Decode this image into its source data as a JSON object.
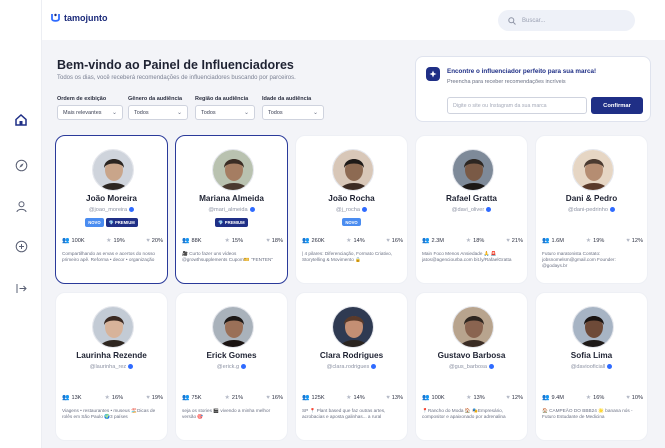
{
  "app": {
    "logo_text": "tamojunto"
  },
  "search": {
    "placeholder": "Buscar..."
  },
  "header": {
    "title": "Bem-vindo ao Painel de Influenciadores",
    "subtitle": "Todos os dias, você receberá recomendações de influenciadores buscando por parceiros."
  },
  "filters": [
    {
      "label": "Ordem de exibição",
      "value": "Mais relevantes"
    },
    {
      "label": "Gênero da audiência",
      "value": "Todos"
    },
    {
      "label": "Região da audiência",
      "value": "Todos"
    },
    {
      "label": "Idade da audiência",
      "value": "Todos"
    }
  ],
  "promo": {
    "title": "Encontre o influenciador perfeito para sua marca!",
    "subtitle": "Preencha para receber recomendações incríveis",
    "input_placeholder": "Digite o site ou Instagram da sua marca",
    "button": "Confirmar"
  },
  "badges": {
    "novo": "NOVO",
    "premium": "💎 PREMIUM"
  },
  "cards": [
    {
      "name": "João Moreira",
      "handle": "@joao_moreira",
      "badges": [
        "novo",
        "premium"
      ],
      "followers": "100K",
      "engagement": "19%",
      "likes": "20%",
      "bio": "Compartilhando as ervas e acertos do nosso primeiro apê. Reforma • decor • organização"
    },
    {
      "name": "Mariana Almeida",
      "handle": "@mari_almeida",
      "badges": [
        "premium"
      ],
      "followers": "88K",
      "engagement": "15%",
      "likes": "18%",
      "bio": "🎥 Curto fazer uns vídeos @growthsupplements Cupom🎫 \"FENTEN\""
    },
    {
      "name": "João Rocha",
      "handle": "@j_rocha",
      "badges": [
        "novo"
      ],
      "followers": "260K",
      "engagement": "14%",
      "likes": "16%",
      "bio": "| 4 pilares: Diferenciação, Formato Criativo, Storytelling & Movimento 🔒"
    },
    {
      "name": "Rafael Gratta",
      "handle": "@davi_oliver",
      "badges": [],
      "followers": "2.3M",
      "engagement": "18%",
      "likes": "21%",
      "bio": "Main Foco Menos Ansiedade 🙏 🚨 jatos@agenciourba.com bit.ly/RafaelGratta"
    },
    {
      "name": "Dani & Pedro",
      "handle": "@dani-pedrinho",
      "badges": [],
      "followers": "1.6M",
      "engagement": "19%",
      "likes": "12%",
      "bio": "Futuro maratonista Contato: jobsnomelsm@gmail.com Founder: @godays.br"
    },
    {
      "name": "Laurinha Rezende",
      "handle": "@laurinha_rez",
      "badges": [],
      "followers": "13K",
      "engagement": "16%",
      "likes": "19%",
      "bio": "Viagens • restaurantes • museus 🏖️Dicas de rolês em São Paulo 🌍3 países"
    },
    {
      "name": "Erick Gomes",
      "handle": "@erick.g",
      "badges": [],
      "followers": "75K",
      "engagement": "21%",
      "likes": "16%",
      "bio": "seja os stories 🎬 vivendo a minha melhor versão 🎯"
    },
    {
      "name": "Clara Rodrigues",
      "handle": "@clara.rodrigues",
      "badges": [],
      "followers": "125K",
      "engagement": "14%",
      "likes": "13%",
      "bio": "SP 📍 Plant based que faz outras artes, acrobacias e aposta galinhas... a rural"
    },
    {
      "name": "Gustavo Barbosa",
      "handle": "@gus_barbosa",
      "badges": [],
      "followers": "100K",
      "engagement": "13%",
      "likes": "12%",
      "bio": "📍Rancho do Moda 🏠 🎭Empresário, compositor e apaixonado por adrenalina"
    },
    {
      "name": "Sofia Lima",
      "handle": "@daviooficiall",
      "badges": [],
      "followers": "9.4M",
      "engagement": "16%",
      "likes": "10%",
      "bio": "🏠 CAMPEÃO DO BBB24 🌟 banana nós - Futuro Estudante de Medicina"
    }
  ],
  "colors": {
    "brand": "#1f2f86",
    "accent": "#2f6bff",
    "selected_border": "#2a3a9a"
  }
}
